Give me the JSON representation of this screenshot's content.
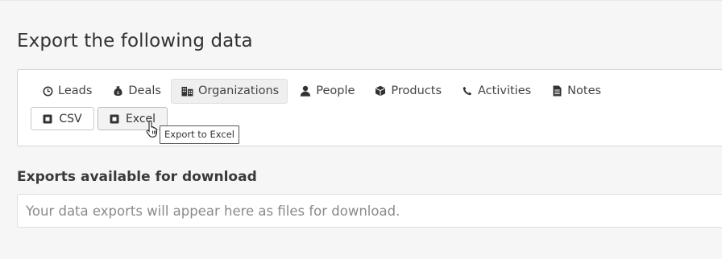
{
  "page": {
    "title": "Export the following data",
    "downloads_title": "Exports available for download",
    "downloads_empty_text": "Your data exports will appear here as files for download."
  },
  "tabs": [
    {
      "label": "Leads",
      "icon": "clock-icon",
      "active": false
    },
    {
      "label": "Deals",
      "icon": "money-bag-icon",
      "active": false
    },
    {
      "label": "Organizations",
      "icon": "buildings-icon",
      "active": true
    },
    {
      "label": "People",
      "icon": "person-icon",
      "active": false
    },
    {
      "label": "Products",
      "icon": "box-icon",
      "active": false
    },
    {
      "label": "Activities",
      "icon": "phone-icon",
      "active": false
    },
    {
      "label": "Notes",
      "icon": "note-icon",
      "active": false
    }
  ],
  "buttons": {
    "csv_label": "CSV",
    "excel_label": "Excel"
  },
  "tooltip": {
    "text": "Export to Excel"
  },
  "colors": {
    "background": "#f6f6f6",
    "panel": "#ffffff",
    "border": "#d4d4d4",
    "active_tab": "#efefef",
    "placeholder_text": "#8a8a8a"
  }
}
